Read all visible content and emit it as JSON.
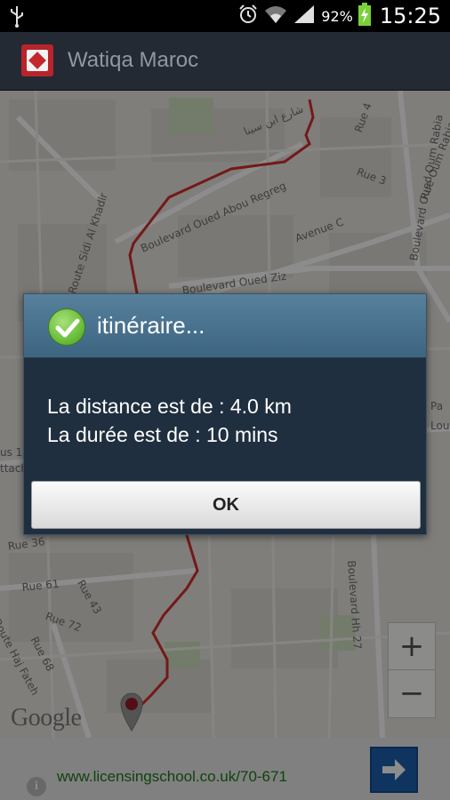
{
  "status_bar": {
    "battery_percent": "92%",
    "time": "15:25",
    "icons": [
      "usb-icon",
      "alarm-icon",
      "wifi-icon",
      "signal-icon",
      "battery-charging-icon"
    ]
  },
  "action_bar": {
    "title": "Watiqa Maroc",
    "icon": "app-logo-icon"
  },
  "map": {
    "street_labels": [
      "Rue 4",
      "Rue Oum Rabia",
      "Rue 3",
      "Boulevard Oued Abou Regreg",
      "Boulevard Oued Oum Rabia",
      "Route Sidi Al Khadir",
      "Avenue C",
      "Boulevard Oued Ziz",
      "Rue 36",
      "Rue 61",
      "Rue 43",
      "Rue 72",
      "Rue 68",
      "Route Haj Fateh",
      "Boulevard Hh 27",
      "شارع ابن سينا",
      "Pa",
      "Lou",
      "us 1",
      "ttach"
    ],
    "google_logo": "Google",
    "zoom_in_label": "+",
    "zoom_out_label": "−",
    "route_color": "#d32e2e"
  },
  "dialog": {
    "title": "itinéraire...",
    "distance_line": "La distance est de : 4.0 km",
    "duration_line": "La durée est de : 10 mins",
    "ok_label": "OK",
    "icon": "check-circle-icon"
  },
  "ad": {
    "url": "www.licensingschool.co.uk/70-671",
    "info_label": "i",
    "arrow_icon": "arrow-right-icon"
  }
}
